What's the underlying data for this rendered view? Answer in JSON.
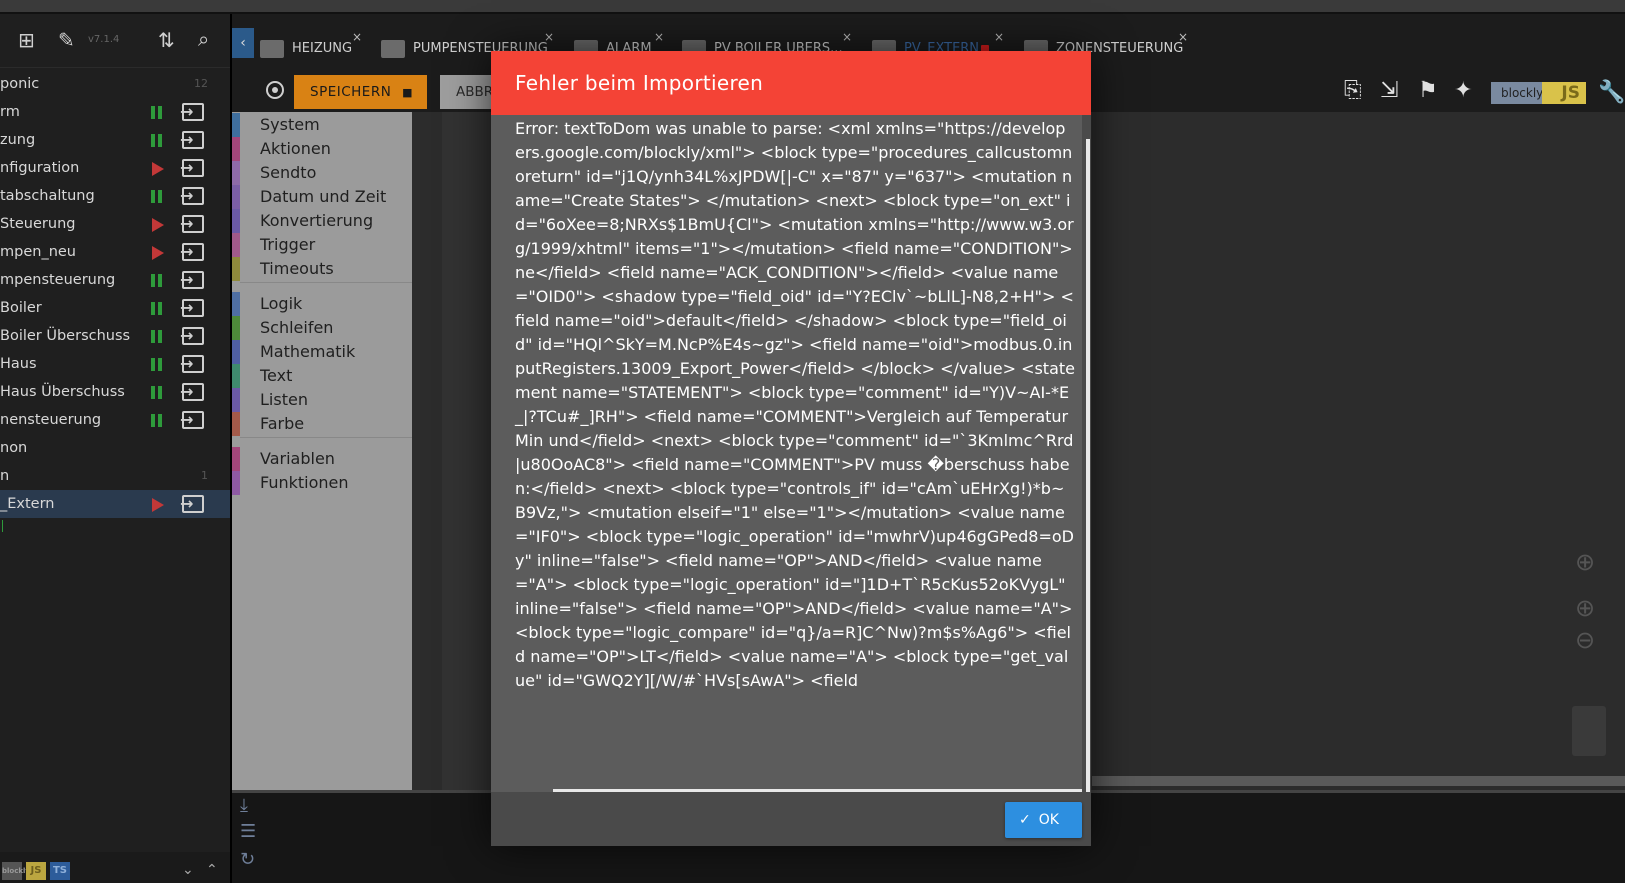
{
  "sidebar": {
    "version": "v7.1.4",
    "scripts": [
      {
        "name": "ponic",
        "state": "none",
        "count": "12"
      },
      {
        "name": "rm",
        "state": "paused",
        "count": ""
      },
      {
        "name": "zung",
        "state": "paused",
        "count": ""
      },
      {
        "name": "nfiguration",
        "state": "stopped",
        "count": ""
      },
      {
        "name": "tabschaltung",
        "state": "paused",
        "count": ""
      },
      {
        "name": "Steuerung",
        "state": "stopped",
        "count": ""
      },
      {
        "name": "mpen_neu",
        "state": "stopped",
        "count": ""
      },
      {
        "name": "mpensteuerung",
        "state": "paused",
        "count": ""
      },
      {
        "name": "Boiler",
        "state": "paused",
        "count": ""
      },
      {
        "name": "Boiler Überschuss",
        "state": "paused",
        "count": ""
      },
      {
        "name": "Haus",
        "state": "paused",
        "count": ""
      },
      {
        "name": "Haus Überschuss",
        "state": "paused",
        "count": ""
      },
      {
        "name": "nensteuerung",
        "state": "paused",
        "count": ""
      },
      {
        "name": "non",
        "state": "none",
        "count": ""
      },
      {
        "name": "n",
        "state": "none",
        "count": "1"
      },
      {
        "name": "_Extern",
        "state": "stopped",
        "count": "",
        "active": true
      }
    ],
    "bottom_logos": [
      "blockly",
      "JS",
      "TS"
    ]
  },
  "tabs": [
    {
      "label": "HEIZUNG",
      "close": "×"
    },
    {
      "label": "PUMPENSTEUERUNG",
      "close": "×"
    },
    {
      "label": "ALARM",
      "close": "×"
    },
    {
      "label": "PV BOILER UBERS...",
      "close": "×"
    },
    {
      "label": "PV_EXTERN",
      "close": "×",
      "active": true
    },
    {
      "label": "ZONENSTEUERUNG",
      "close": "×"
    }
  ],
  "toolbar": {
    "save_label": "SPEICHERN",
    "abort_label": "ABBR",
    "blockly_label": "blockly",
    "js_label": "JS"
  },
  "categories": [
    {
      "label": "System",
      "color": "#3f6f9e"
    },
    {
      "label": "Aktionen",
      "color": "#a3467a"
    },
    {
      "label": "Sendto",
      "color": "#8e6aa8"
    },
    {
      "label": "Datum und Zeit",
      "color": "#7b5ea6"
    },
    {
      "label": "Konvertierung",
      "color": "#6a5aa6"
    },
    {
      "label": "Trigger",
      "color": "#a05a8a"
    },
    {
      "label": "Timeouts",
      "color": "#8f8a3c"
    },
    {
      "label": "Logik",
      "color": "#4f6fa3"
    },
    {
      "label": "Schleifen",
      "color": "#4e8a3a"
    },
    {
      "label": "Mathematik",
      "color": "#4f5fa3"
    },
    {
      "label": "Text",
      "color": "#3f8a6e"
    },
    {
      "label": "Listen",
      "color": "#6a5aa6"
    },
    {
      "label": "Farbe",
      "color": "#a35a4a"
    },
    {
      "label": "Variablen",
      "color": "#a3467a"
    },
    {
      "label": "Funktionen",
      "color": "#8e5aa3"
    }
  ],
  "modal": {
    "title": "Fehler beim Importieren",
    "message": "Error: textToDom was unable to parse: <xml xmlns=\"https://developers.google.com/blockly/xml\"> <block type=\"procedures_callcustomnoreturn\" id=\"j1Q/ynh34L%xJPDW[|-C\" x=\"87\" y=\"637\"> <mutation name=\"Create States\"> </mutation> <next> <block type=\"on_ext\" id=\"6oXee=8;NRXs$1BmU{Cl\"> <mutation xmlns=\"http://www.w3.org/1999/xhtml\" items=\"1\"></mutation> <field name=\"CONDITION\">ne</field> <field name=\"ACK_CONDITION\"></field> <value name=\"OID0\"> <shadow type=\"field_oid\" id=\"Y?EClv`~bLlL]-N8,2+H\"> <field name=\"oid\">default</field> </shadow> <block type=\"field_oid\" id=\"HQl^SkY=M.NcP%E4s~gz\"> <field name=\"oid\">modbus.0.inputRegisters.13009_Export_Power</field> </block> </value> <statement name=\"STATEMENT\"> <block type=\"comment\" id=\"Y)V~AI-*E_|?TCu#_]RH\"> <field name=\"COMMENT\">Vergleich auf Temperatur Min und</field> <next> <block type=\"comment\" id=\"`3Kmlmc^Rrd|u80OoAC8\"> <field name=\"COMMENT\">PV muss �berschuss haben:</field> <next> <block type=\"controls_if\" id=\"cAm`uEHrXg!)*b~B9Vz,\"> <mutation elseif=\"1\" else=\"1\"></mutation> <value name=\"IF0\"> <block type=\"logic_operation\" id=\"mwhrV)up46gGPed8=oDy\" inline=\"false\"> <field name=\"OP\">AND</field> <value name=\"A\"> <block type=\"logic_operation\" id=\"]1D+T`R5cKus52oKVygL\" inline=\"false\"> <field name=\"OP\">AND</field> <value name=\"A\"> <block type=\"logic_compare\" id=\"q}/a=R]C^Nw)?m$s%Ag6\"> <field name=\"OP\">LT</field> <value name=\"A\"> <block type=\"get_value\" id=\"GWQ2Y][/W/#`HVs[sAwA\"> <field",
    "ok_label": "OK",
    "header_color": "#f44336"
  }
}
